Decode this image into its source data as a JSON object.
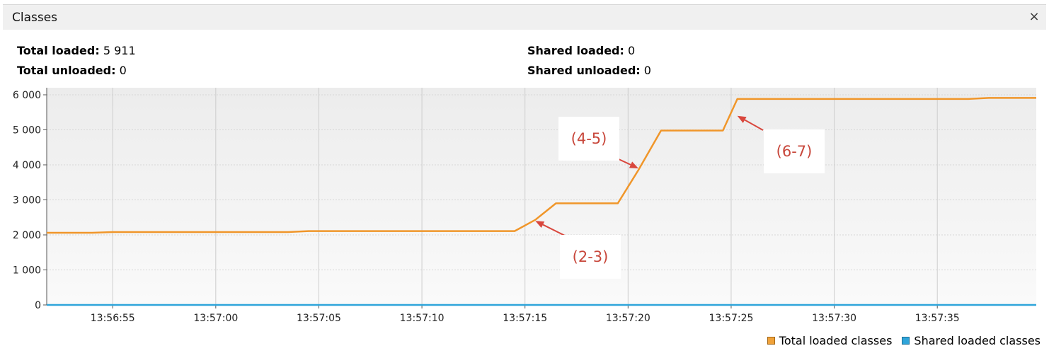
{
  "window": {
    "title": "Classes",
    "close_glyph": "×"
  },
  "stats": {
    "total_loaded_label": "Total loaded:",
    "total_loaded_value": "5 911",
    "total_unloaded_label": "Total unloaded:",
    "total_unloaded_value": "0",
    "shared_loaded_label": "Shared loaded:",
    "shared_loaded_value": "0",
    "shared_unloaded_label": "Shared unloaded:",
    "shared_unloaded_value": "0"
  },
  "chart_data": {
    "type": "line",
    "x_unit": "time (hh:mm:ss)",
    "x_range": [
      "13:56:51.8",
      "13:57:39.8"
    ],
    "ylim": [
      0,
      6000
    ],
    "y_ticks": [
      0,
      1000,
      2000,
      3000,
      4000,
      5000,
      6000
    ],
    "y_tick_labels": [
      "0",
      "1 000",
      "2 000",
      "3 000",
      "4 000",
      "5 000",
      "6 000"
    ],
    "x_ticks": [
      "13:56:55",
      "13:57:00",
      "13:57:05",
      "13:57:10",
      "13:57:15",
      "13:57:20",
      "13:57:25",
      "13:57:30",
      "13:57:35"
    ],
    "grid": true,
    "legend_position": "bottom-right",
    "series": [
      {
        "name": "Total loaded classes",
        "color": "#f0962a",
        "points": [
          [
            "13:56:51.8",
            2060
          ],
          [
            "13:56:54.0",
            2060
          ],
          [
            "13:56:55.0",
            2080
          ],
          [
            "13:57:03.5",
            2080
          ],
          [
            "13:57:04.5",
            2110
          ],
          [
            "13:57:14.5",
            2110
          ],
          [
            "13:57:15.5",
            2430
          ],
          [
            "13:57:16.5",
            2900
          ],
          [
            "13:57:19.5",
            2900
          ],
          [
            "13:57:20.5",
            3850
          ],
          [
            "13:57:21.6",
            4980
          ],
          [
            "13:57:24.6",
            4980
          ],
          [
            "13:57:25.3",
            5880
          ],
          [
            "13:57:36.5",
            5880
          ],
          [
            "13:57:37.5",
            5911
          ],
          [
            "13:57:39.8",
            5911
          ]
        ]
      },
      {
        "name": "Shared loaded classes",
        "color": "#2fa5da",
        "points": [
          [
            "13:56:51.8",
            0
          ],
          [
            "13:57:39.8",
            0
          ]
        ]
      }
    ],
    "annotations": [
      {
        "label": "(2-3)",
        "x": "13:57:15.5",
        "y": 2400
      },
      {
        "label": "(4-5)",
        "x": "13:57:20.5",
        "y": 3900
      },
      {
        "label": "(6-7)",
        "x": "13:57:25.3",
        "y": 5400
      }
    ]
  },
  "legend": {
    "total_label": "Total loaded classes",
    "shared_label": "Shared loaded classes"
  }
}
